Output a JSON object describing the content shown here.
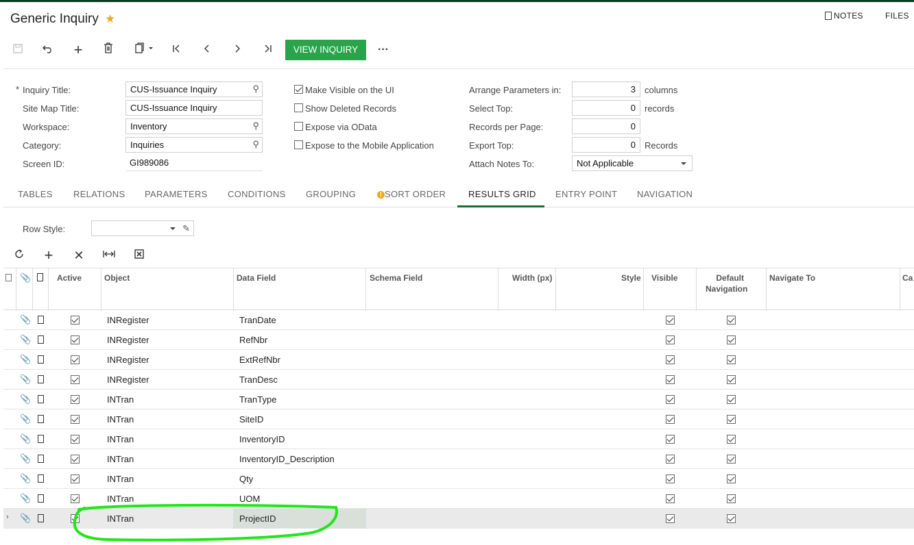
{
  "header": {
    "title": "Generic Inquiry",
    "notes_label": "NOTES",
    "files_label": "FILES"
  },
  "toolbar": {
    "icons": [
      "save-icon",
      "undo-icon",
      "add-icon",
      "delete-icon",
      "copy-paste-icon",
      "first-icon",
      "prev-icon",
      "next-icon",
      "last-icon"
    ],
    "view_inquiry_label": "VIEW INQUIRY",
    "more_label": "···"
  },
  "form": {
    "inquiry_title_label": "Inquiry Title:",
    "inquiry_title_value": "CUS-Issuance Inquiry",
    "site_map_title_label": "Site Map Title:",
    "site_map_title_value": "CUS-Issuance Inquiry",
    "workspace_label": "Workspace:",
    "workspace_value": "Inventory",
    "category_label": "Category:",
    "category_value": "Inquiries",
    "screen_id_label": "Screen ID:",
    "screen_id_value": "GI989086",
    "make_visible_label": "Make Visible on the UI",
    "show_deleted_label": "Show Deleted Records",
    "expose_odata_label": "Expose via OData",
    "expose_mobile_label": "Expose to the Mobile Application",
    "arrange_label": "Arrange Parameters in:",
    "arrange_value": "3",
    "arrange_unit": "columns",
    "select_top_label": "Select Top:",
    "select_top_value": "0",
    "select_top_unit": "records",
    "records_per_page_label": "Records per Page:",
    "records_per_page_value": "0",
    "export_top_label": "Export Top:",
    "export_top_value": "0",
    "export_top_unit": "Records",
    "attach_notes_label": "Attach Notes To:",
    "attach_notes_value": "Not Applicable"
  },
  "tabs": [
    "TABLES",
    "RELATIONS",
    "PARAMETERS",
    "CONDITIONS",
    "GROUPING",
    "SORT ORDER",
    "RESULTS GRID",
    "ENTRY POINT",
    "NAVIGATION"
  ],
  "row_style": {
    "label": "Row Style:",
    "value": ""
  },
  "grid": {
    "headers": {
      "active": "Active",
      "object": "Object",
      "data_field": "Data Field",
      "schema_field": "Schema Field",
      "width": "Width (px)",
      "style": "Style",
      "visible": "Visible",
      "default_nav_1": "Default",
      "default_nav_2": "Navigation",
      "navigate_to": "Navigate To",
      "caption": "Ca"
    },
    "rows": [
      {
        "object": "INRegister",
        "data_field": "TranDate"
      },
      {
        "object": "INRegister",
        "data_field": "RefNbr"
      },
      {
        "object": "INRegister",
        "data_field": "ExtRefNbr"
      },
      {
        "object": "INRegister",
        "data_field": "TranDesc"
      },
      {
        "object": "INTran",
        "data_field": "TranType"
      },
      {
        "object": "INTran",
        "data_field": "SiteID"
      },
      {
        "object": "INTran",
        "data_field": "InventoryID"
      },
      {
        "object": "INTran",
        "data_field": "InventoryID_Description"
      },
      {
        "object": "INTran",
        "data_field": "Qty"
      },
      {
        "object": "INTran",
        "data_field": "UOM"
      },
      {
        "object": "INTran",
        "data_field": "ProjectID"
      }
    ]
  },
  "colors": {
    "accent": "#2aa34a",
    "highlight_ink": "#22e51a"
  }
}
